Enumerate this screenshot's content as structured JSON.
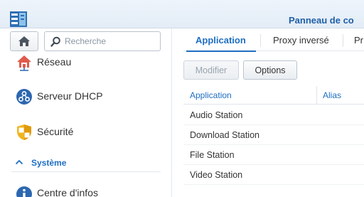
{
  "window": {
    "title": "Panneau de co"
  },
  "sidebar": {
    "search_placeholder": "Recherche",
    "items": [
      {
        "label": "Réseau",
        "icon": "house-network-icon"
      },
      {
        "label": "Serveur DHCP",
        "icon": "dhcp-server-icon"
      },
      {
        "label": "Sécurité",
        "icon": "shield-icon"
      }
    ],
    "section": {
      "label": "Système",
      "icon": "chevron-up-icon"
    },
    "section_items": [
      {
        "label": "Centre d'infos",
        "icon": "info-icon"
      }
    ]
  },
  "tabs": [
    {
      "label": "Application",
      "active": true
    },
    {
      "label": "Proxy inversé",
      "active": false
    },
    {
      "label": "Pr",
      "active": false
    }
  ],
  "toolbar": {
    "modify_label": "Modifier",
    "options_label": "Options"
  },
  "grid": {
    "columns": [
      "Application",
      "Alias"
    ],
    "rows": [
      {
        "application": "Audio Station",
        "alias": ""
      },
      {
        "application": "Download Station",
        "alias": ""
      },
      {
        "application": "File Station",
        "alias": ""
      },
      {
        "application": "Video Station",
        "alias": ""
      }
    ]
  },
  "colors": {
    "accent": "#1e6ec2",
    "title": "#1e5fa8"
  }
}
